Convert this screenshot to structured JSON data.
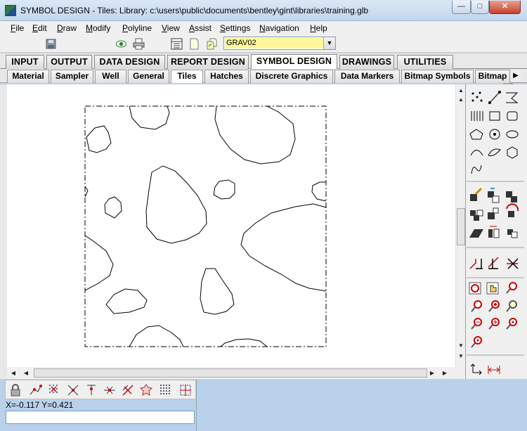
{
  "window": {
    "title": "SYMBOL DESIGN -  Tiles:  Library: c:\\users\\public\\documents\\bentley\\gint\\libraries\\training.glb"
  },
  "menu": [
    {
      "label": "File",
      "key": "F"
    },
    {
      "label": "Edit",
      "key": "E"
    },
    {
      "label": "Draw",
      "key": "D"
    },
    {
      "label": "Modify",
      "key": "M"
    },
    {
      "label": "Polyline",
      "key": "P"
    },
    {
      "label": "View",
      "key": "V"
    },
    {
      "label": "Assist",
      "key": "A"
    },
    {
      "label": "Settings",
      "key": "S"
    },
    {
      "label": "Navigation",
      "key": "N"
    },
    {
      "label": "Help",
      "key": "H"
    }
  ],
  "toolbar": {
    "symbol_combo_value": "GRAV02"
  },
  "main_tabs": [
    "INPUT",
    "OUTPUT",
    "DATA DESIGN",
    "REPORT DESIGN",
    "SYMBOL DESIGN",
    "DRAWINGS",
    "UTILITIES"
  ],
  "main_tabs_active": "SYMBOL DESIGN",
  "sub_tabs": [
    "Material",
    "Sampler",
    "Well",
    "General",
    "Tiles",
    "Hatches",
    "Discrete Graphics",
    "Data Markers",
    "Bitmap Symbols",
    "Bitmap"
  ],
  "sub_tabs_active": "Tiles",
  "status": {
    "coords": "X=-0.117   Y=0.421"
  },
  "colors": {
    "accent": "#b9d1ea",
    "combo_highlight": "#fff799"
  }
}
